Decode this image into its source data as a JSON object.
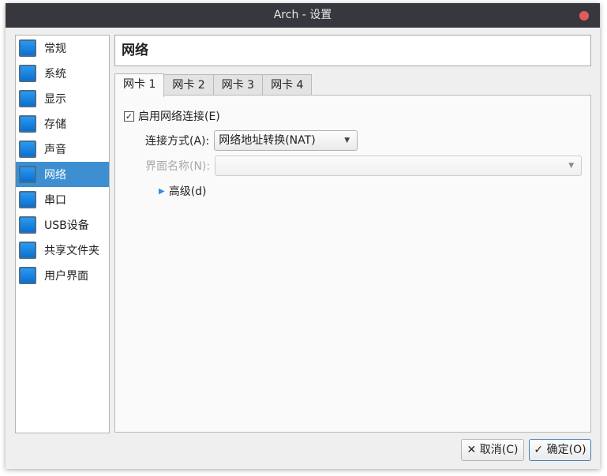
{
  "window": {
    "title": "Arch - 设置"
  },
  "sidebar": {
    "items": [
      {
        "label": "常规",
        "icon": "general-icon"
      },
      {
        "label": "系统",
        "icon": "system-icon"
      },
      {
        "label": "显示",
        "icon": "display-icon"
      },
      {
        "label": "存储",
        "icon": "storage-icon"
      },
      {
        "label": "声音",
        "icon": "audio-icon"
      },
      {
        "label": "网络",
        "icon": "network-icon",
        "selected": true
      },
      {
        "label": "串口",
        "icon": "serial-port-icon"
      },
      {
        "label": "USB设备",
        "icon": "usb-icon"
      },
      {
        "label": "共享文件夹",
        "icon": "shared-folder-icon"
      },
      {
        "label": "用户界面",
        "icon": "user-interface-icon"
      }
    ]
  },
  "header": {
    "title": "网络"
  },
  "tabs": [
    "网卡 1",
    "网卡 2",
    "网卡 3",
    "网卡 4"
  ],
  "adapter": {
    "enable_label": "启用网络连接(E)",
    "enabled": true,
    "attached_label": "连接方式(A):",
    "attached_value": "网络地址转换(NAT)",
    "name_label": "界面名称(N):",
    "name_value": "",
    "advanced_label": "高级(d)"
  },
  "buttons": {
    "cancel": "取消(C)",
    "ok": "确定(O)"
  }
}
